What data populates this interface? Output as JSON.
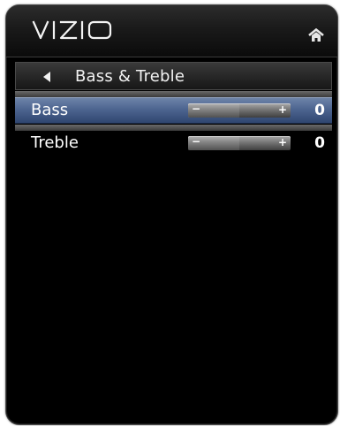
{
  "header": {
    "brand": "VIZIO",
    "home_icon": "home-icon"
  },
  "breadcrumb": {
    "back_icon": "back-arrow-icon",
    "title": "Bass & Treble"
  },
  "rows": [
    {
      "label": "Bass",
      "minus": "−",
      "plus": "+",
      "value": "0",
      "level": 0.5,
      "selected": true
    },
    {
      "label": "Treble",
      "minus": "−",
      "plus": "+",
      "value": "0",
      "level": 0.5,
      "selected": false
    }
  ],
  "colors": {
    "panel_bg": "#000000",
    "selection": "#4d6590",
    "text": "#ffffff"
  }
}
